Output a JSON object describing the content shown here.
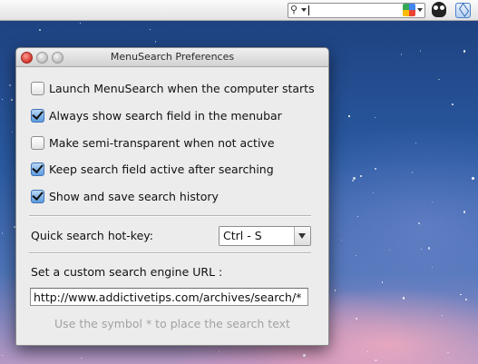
{
  "window": {
    "title": "MenuSearch Preferences"
  },
  "options": [
    {
      "label": "Launch MenuSearch when the computer starts",
      "checked": false
    },
    {
      "label": "Always show search field in the menubar",
      "checked": true
    },
    {
      "label": "Make semi-transparent when not active",
      "checked": false
    },
    {
      "label": "Keep search field active after searching",
      "checked": true
    },
    {
      "label": "Show and save search history",
      "checked": true
    }
  ],
  "hotkey": {
    "label": "Quick search hot-key:",
    "value": "Ctrl - S"
  },
  "custom_url": {
    "label": "Set a custom search engine URL :",
    "value": "http://www.addictivetips.com/archives/search/*",
    "hint": "Use the symbol * to place the search text"
  },
  "menubar": {
    "search_value": "",
    "icons": [
      "magnifier-dropdown-icon",
      "google-icon",
      "owl-icon",
      "dropbox-icon"
    ]
  }
}
